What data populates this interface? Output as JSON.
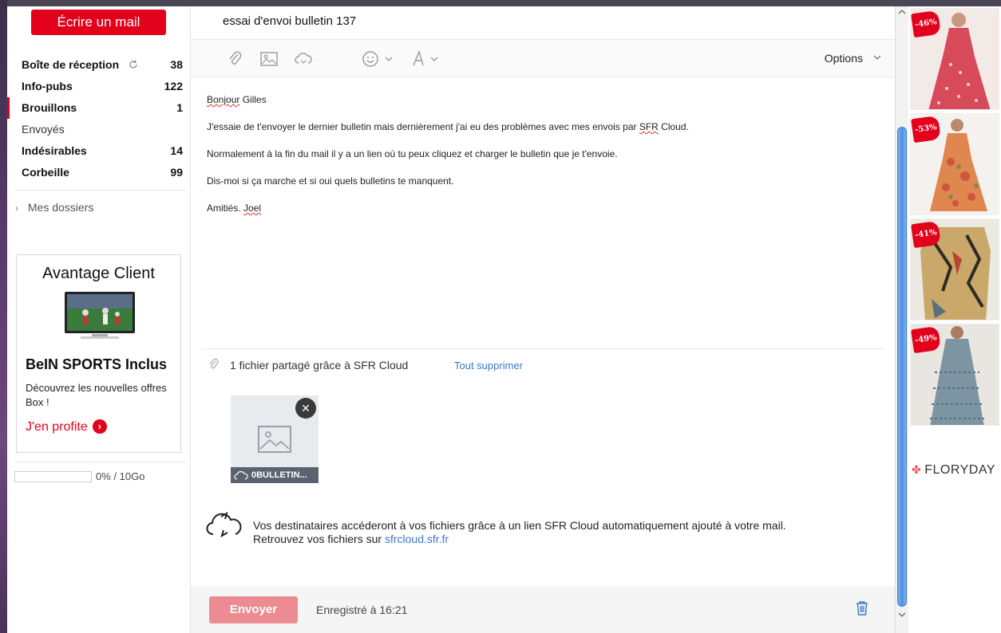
{
  "sidebar": {
    "compose_label": "Écrire un mail",
    "folders": [
      {
        "label": "Boîte de réception",
        "count": "38"
      },
      {
        "label": "Info-pubs",
        "count": "122"
      },
      {
        "label": "Brouillons",
        "count": "1"
      },
      {
        "label": "Envoyés",
        "count": ""
      },
      {
        "label": "Indésirables",
        "count": "14"
      },
      {
        "label": "Corbeille",
        "count": "99"
      }
    ],
    "mes_dossiers": "Mes dossiers",
    "promo": {
      "title": "Avantage Client",
      "headline": "BeIN SPORTS Inclus",
      "text": "Découvrez les nouvelles offres Box !",
      "link": "J'en profite"
    },
    "storage": {
      "text": "0% / 10Go",
      "used_fraction": 0
    }
  },
  "compose": {
    "subject": "essai d'envoi bulletin 137",
    "options_label": "Options",
    "body": {
      "greeting_word": "Bonjour",
      "greeting_name": "Gilles",
      "line1_pre": "J'essaie de t'envoyer le dernier bulletin mais dernièrement j'ai eu des problèmes avec mes envois par",
      "line1_spell": "SFR",
      "line1_post": "Cloud.",
      "line2": "Normalement à la fin du mail il y a un lien où tu peux cliquez et charger le bulletin que je t'envoie.",
      "line3": "Dis-moi si ça marche et si oui quels bulletins te manquent.",
      "sign_pre": "Amitiés.",
      "sign_name": "Joel"
    },
    "attachments": {
      "label": "1 fichier partagé grâce à SFR Cloud",
      "remove_all": "Tout supprimer",
      "file_name": "0BULLETIN..."
    },
    "cloud_info": {
      "line1": "Vos destinataires accéderont à vos fichiers grâce à un lien SFR Cloud automatiquement ajouté à votre mail.",
      "line2_pre": "Retrouvez vos fichiers sur",
      "line2_link": "sfrcloud.sfr.fr"
    },
    "footer": {
      "send_label": "Envoyer",
      "saved_text": "Enregistré à 16:21"
    }
  },
  "ads": {
    "badges": [
      "-46%",
      "-53%",
      "-41%",
      "-49%"
    ],
    "brand": "FLORYDAY"
  },
  "colors": {
    "brand_red": "#e2001a",
    "send_disabled": "#ec8b92",
    "link_blue": "#3c78c8"
  }
}
